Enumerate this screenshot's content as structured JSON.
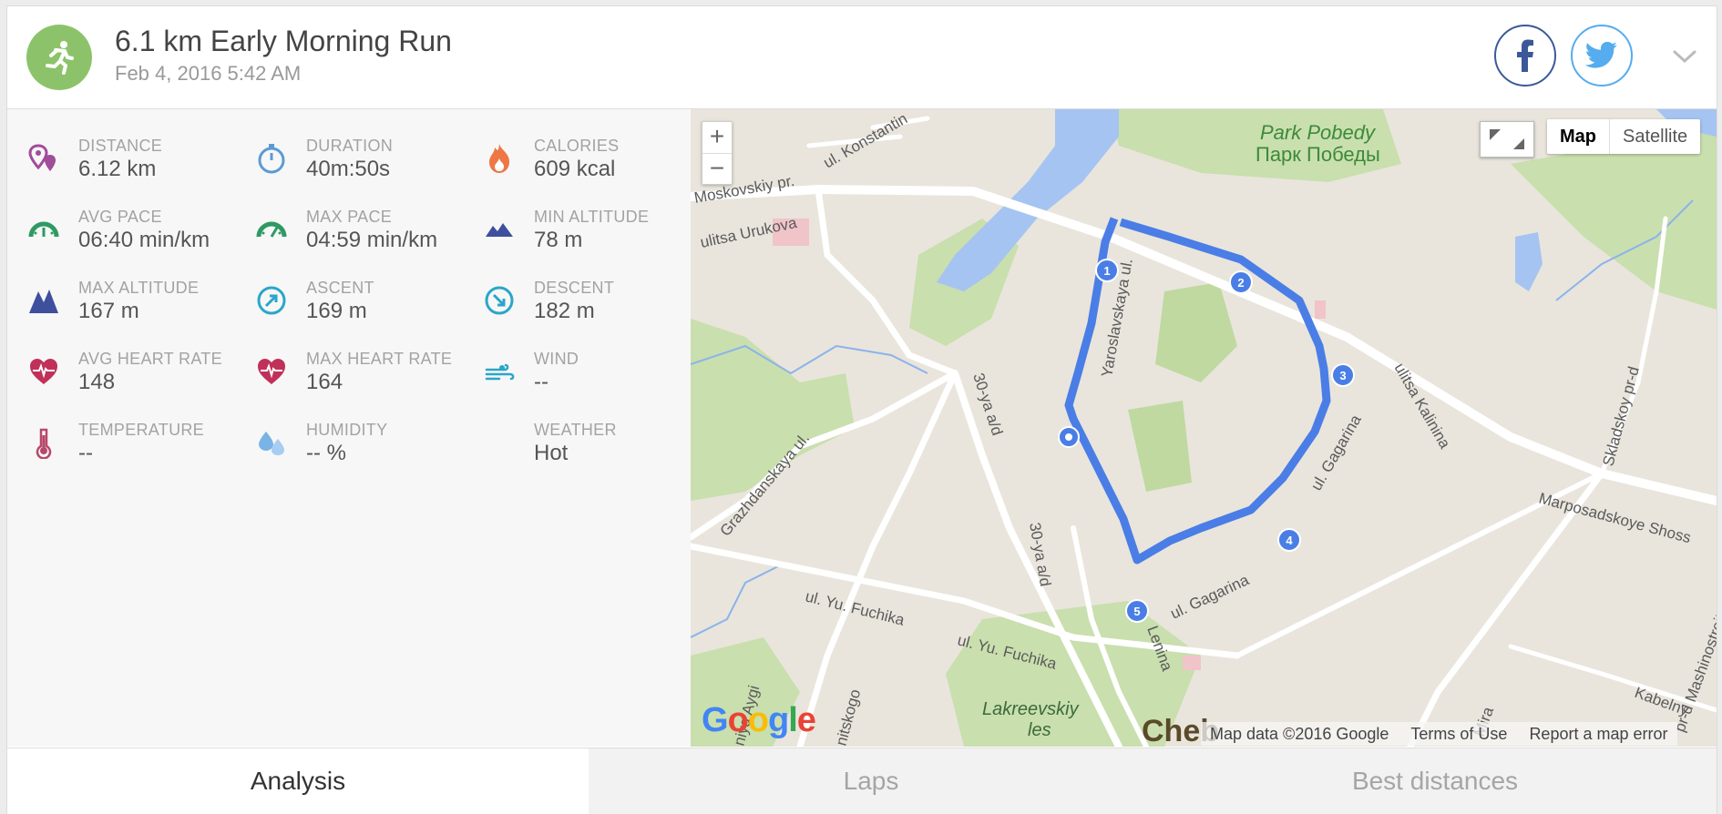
{
  "activity": {
    "title": "6.1 km Early Morning Run",
    "date": "Feb 4, 2016 5:42 AM",
    "icon": "running-icon",
    "accent": "#8cc36a"
  },
  "social": {
    "facebook_icon": "facebook-icon",
    "twitter_icon": "twitter-icon",
    "expand_icon": "chevron-down-icon"
  },
  "stats": [
    {
      "label": "DISTANCE",
      "value": "6.12 km",
      "icon": "location-pins-icon",
      "color": "#a04d9a"
    },
    {
      "label": "DURATION",
      "value": "40m:50s",
      "icon": "stopwatch-icon",
      "color": "#5b9bd5"
    },
    {
      "label": "CALORIES",
      "value": "609 kcal",
      "icon": "flame-icon",
      "color": "#ee7745"
    },
    {
      "label": "AVG PACE",
      "value": "06:40 min/km",
      "icon": "speedometer-icon",
      "color": "#2e9a63"
    },
    {
      "label": "MAX PACE",
      "value": "04:59 min/km",
      "icon": "speedometer-icon",
      "color": "#2e9a63"
    },
    {
      "label": "MIN ALTITUDE",
      "value": "78 m",
      "icon": "mountains-low-icon",
      "color": "#3e4f9e"
    },
    {
      "label": "MAX ALTITUDE",
      "value": "167 m",
      "icon": "mountains-high-icon",
      "color": "#3e4f9e"
    },
    {
      "label": "ASCENT",
      "value": "169 m",
      "icon": "ascent-icon",
      "color": "#2aa6c8"
    },
    {
      "label": "DESCENT",
      "value": "182 m",
      "icon": "descent-icon",
      "color": "#2aa6c8"
    },
    {
      "label": "AVG HEART RATE",
      "value": "148",
      "icon": "heart-rate-icon",
      "color": "#c0315a"
    },
    {
      "label": "MAX HEART RATE",
      "value": "164",
      "icon": "heart-rate-icon",
      "color": "#c0315a"
    },
    {
      "label": "WIND",
      "value": "--",
      "icon": "wind-icon",
      "color": "#2aa6c8"
    },
    {
      "label": "TEMPERATURE",
      "value": "--",
      "icon": "thermometer-icon",
      "color": "#b8486a"
    },
    {
      "label": "HUMIDITY",
      "value": "-- %",
      "icon": "water-drops-icon",
      "color": "#7ab3e6"
    },
    {
      "label": "WEATHER",
      "value": "Hot",
      "icon": "",
      "color": ""
    }
  ],
  "map": {
    "zoom_in": "+",
    "zoom_out": "−",
    "type_map": "Map",
    "type_satellite": "Satellite",
    "attribution": "Map data ©2016 Google",
    "terms": "Terms of Use",
    "report": "Report a map error",
    "route_color": "#4a7ee6",
    "labels": {
      "park_en": "Park Pobedy",
      "park_ru": "Парк Победы",
      "moskovskiy": "Moskovskiy pr.",
      "konstantin": "ul. Konstantin",
      "urukova": "ulitsa Urukova",
      "yaroslavskaya": "Yaroslavskaya ul.",
      "kalinina": "ulitsa Kalinina",
      "sklad": "Skladskoy pr-d",
      "marposad": "Marposadskoye Shoss",
      "grazhd": "Grazhdanskaya ul.",
      "ad30a": "30-ya a/d",
      "ad30b": "30-ya a/d",
      "fuchika1": "ul. Yu. Fuchika",
      "fuchika2": "ul. Yu. Fuchika",
      "gagarina1": "ul. Gagarina",
      "gagarina2": "ul. Gagarina",
      "lenina": "Lenina",
      "lakreevskiy": "Lakreevskiy",
      "les": "les",
      "mira": "Mira",
      "kabelny": "Kabelny",
      "mashino": "pr-d Mashinostroit",
      "aygi": "niya Aygi",
      "nitskogo": "nitskogo",
      "cheb": "Cheb",
      "google": "Google"
    },
    "markers": [
      "1",
      "2",
      "3",
      "4",
      "5"
    ]
  },
  "tabs": [
    {
      "label": "Analysis",
      "active": true
    },
    {
      "label": "Laps",
      "active": false
    },
    {
      "label": "Best distances",
      "active": false
    }
  ]
}
